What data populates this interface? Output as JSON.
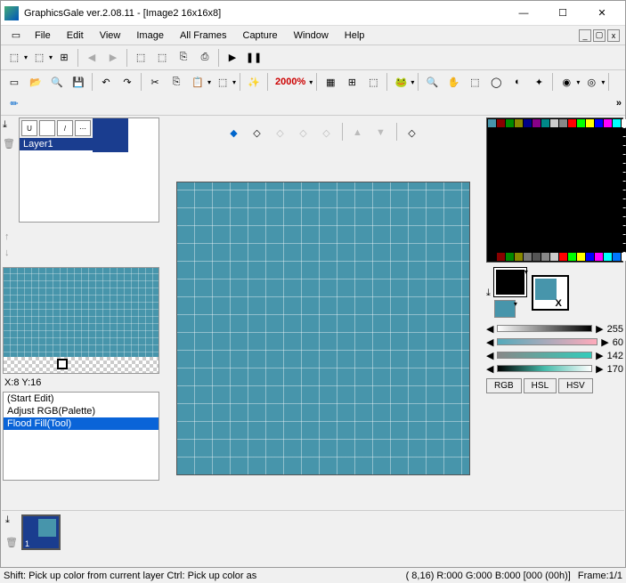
{
  "title": "GraphicsGale ver.2.08.11 - [Image2 16x16x8]",
  "menu": [
    "File",
    "Edit",
    "View",
    "Image",
    "All Frames",
    "Capture",
    "Window",
    "Help"
  ],
  "zoom": "2000%",
  "layer": {
    "name": "Layer1"
  },
  "coord": "X:8 Y:16",
  "history": [
    "(Start Edit)",
    "Adjust RGB(Palette)",
    "Flood Fill(Tool)"
  ],
  "history_selected": 2,
  "sliders": {
    "a": 255,
    "h": 60,
    "s": 142,
    "l": 170
  },
  "color_tabs": [
    "RGB",
    "HSL",
    "HSV"
  ],
  "frame_num": "1",
  "status": {
    "hint": "Shift: Pick up color from current layer  Ctrl: Pick up color as",
    "pos": "( 8,16) R:000 G:000 B:000  [000 (00h)]",
    "frame": "Frame:1/1"
  },
  "x_label": "X",
  "palette_first_row": [
    "#4795ab",
    "#800",
    "#080",
    "#880",
    "#008",
    "#808",
    "#088",
    "#ccc",
    "#888",
    "#f00",
    "#0f0",
    "#ff0",
    "#00f",
    "#f0f",
    "#0ff",
    "#fff"
  ],
  "palette_last_row": [
    "#000",
    "#800",
    "#080",
    "#880",
    "#777",
    "#555",
    "#888",
    "#ccc",
    "#f00",
    "#0f0",
    "#ff0",
    "#00f",
    "#f0f",
    "#0ff",
    "#07f",
    "#fff"
  ]
}
